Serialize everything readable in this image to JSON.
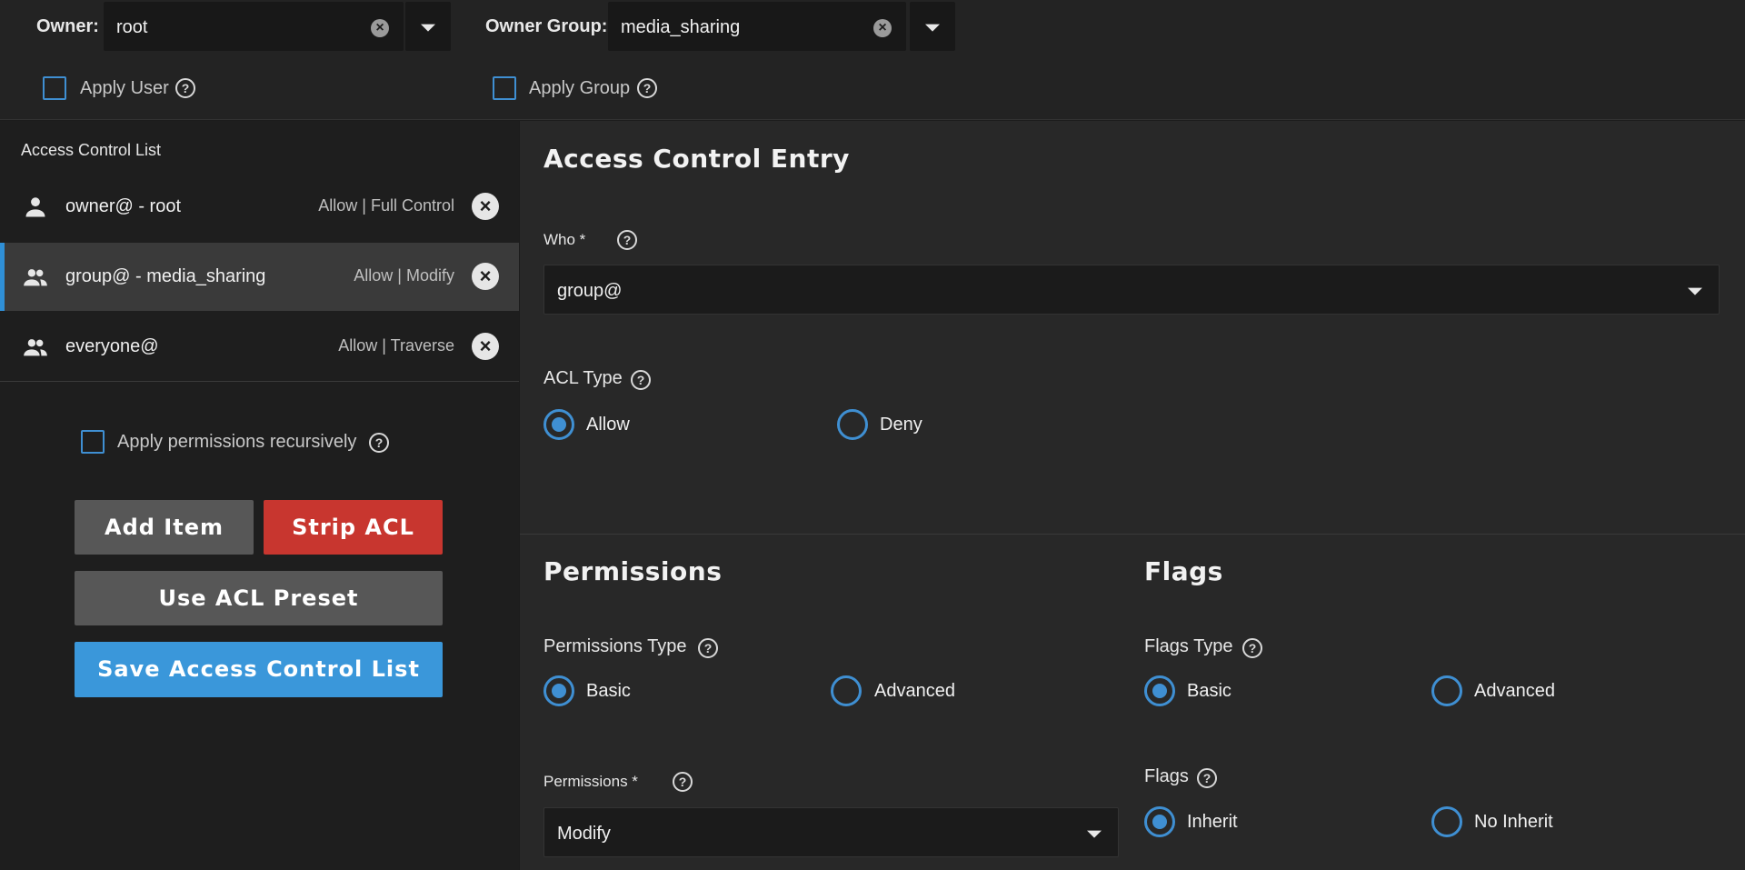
{
  "owner": {
    "label": "Owner:",
    "value": "root",
    "apply_label": "Apply User"
  },
  "owner_group": {
    "label": "Owner Group:",
    "value": "media_sharing",
    "apply_label": "Apply Group"
  },
  "acl_list": {
    "header": "Access Control List",
    "items": [
      {
        "who": "owner@ - root",
        "perm": "Allow | Full Control",
        "icon": "person-icon",
        "selected": false
      },
      {
        "who": "group@ - media_sharing",
        "perm": "Allow | Modify",
        "icon": "group-icon",
        "selected": true
      },
      {
        "who": "everyone@",
        "perm": "Allow | Traverse",
        "icon": "group-icon",
        "selected": false
      }
    ],
    "recursive_label": "Apply permissions recursively"
  },
  "buttons": {
    "add_item": "Add Item",
    "strip_acl": "Strip ACL",
    "use_preset": "Use ACL Preset",
    "save": "Save Access Control List"
  },
  "ace": {
    "title": "Access Control Entry",
    "who_label": "Who *",
    "who_value": "group@",
    "acl_type_label": "ACL Type",
    "acl_type_options": [
      "Allow",
      "Deny"
    ],
    "acl_type_selected": "Allow"
  },
  "permissions": {
    "title": "Permissions",
    "type_label": "Permissions Type",
    "type_options": [
      "Basic",
      "Advanced"
    ],
    "type_selected": "Basic",
    "perm_label": "Permissions *",
    "perm_value": "Modify"
  },
  "flags": {
    "title": "Flags",
    "type_label": "Flags Type",
    "type_options": [
      "Basic",
      "Advanced"
    ],
    "type_selected": "Basic",
    "flags_label": "Flags",
    "flags_options": [
      "Inherit",
      "No Inherit"
    ],
    "flags_selected": "Inherit"
  },
  "colors": {
    "accent": "#3f8fd2",
    "danger": "#c8362f",
    "primary_button": "#3a97da"
  }
}
